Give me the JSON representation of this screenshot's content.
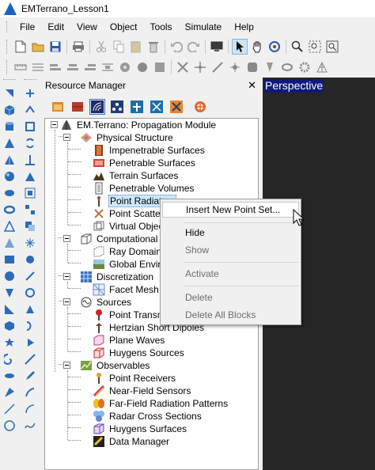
{
  "window": {
    "title": "EMTerrano_Lesson1"
  },
  "menubar": {
    "items": [
      "File",
      "Edit",
      "View",
      "Object",
      "Tools",
      "Simulate",
      "Help"
    ]
  },
  "toolbar1": {
    "icons": [
      "new-icon",
      "open-icon",
      "save-icon",
      "print-icon",
      "cut-icon",
      "copy-icon",
      "paste-icon",
      "delete-icon",
      "undo-icon",
      "redo-icon",
      "display-icon",
      "pointer-icon",
      "pan-icon",
      "rotate-icon",
      "zoom-icon",
      "zoom-window-icon",
      "zoom-fit-icon"
    ]
  },
  "toolbar2": {
    "icons": [
      "ruler-icon",
      "grid-icon",
      "align-left-icon",
      "align-center-icon",
      "align-right-icon",
      "distribute-icon",
      "cylinder-icon",
      "sphere-icon",
      "disk-icon",
      "scissors-icon",
      "snap-icon",
      "line-icon",
      "point-icon",
      "shield-icon",
      "cone-icon",
      "lens-icon",
      "gear-icon",
      "mesh-icon"
    ]
  },
  "left_palette": {
    "column1": [
      "arrow-icon",
      "box-icon",
      "cylinder-icon",
      "cone-icon",
      "pyramid-icon",
      "sphere-icon",
      "disk-icon",
      "torus-icon",
      "wedge-icon",
      "prism-icon",
      "rectangle-icon",
      "circle-icon",
      "polygon-icon",
      "triangle-icon",
      "hexagon-icon",
      "star-icon",
      "spiral-icon",
      "heart-icon",
      "sector-icon",
      "line-icon",
      "curve-icon"
    ],
    "column2": [
      "move-icon",
      "rotate-icon",
      "scale-icon",
      "mirror-icon",
      "array-icon",
      "group-icon",
      "split-icon",
      "join-icon",
      "boolean-icon",
      "fillet-icon",
      "offset-icon",
      "extrude-icon",
      "revolve-icon",
      "sweep-icon",
      "loft-icon",
      "shell-icon",
      "chamfer-icon",
      "pencil-icon",
      "measure-icon",
      "arc-icon",
      "spline-icon"
    ]
  },
  "resource_manager": {
    "title": "Resource Manager",
    "close_symbol": "✕",
    "tools": [
      "open-folder-icon",
      "material-icon",
      "signal-icon",
      "nodes-icon",
      "antenna-icon",
      "network-icon",
      "cross-arrows-icon",
      "target-icon"
    ],
    "root": "EM.Terrano: Propagation Module",
    "tree": [
      {
        "label": "Physical Structure",
        "level": 1,
        "expandable": true,
        "icon": "structure-icon"
      },
      {
        "label": "Impenetrable Surfaces",
        "level": 2,
        "icon": "impenetrable-surface-icon"
      },
      {
        "label": "Penetrable Surfaces",
        "level": 2,
        "icon": "penetrable-surface-icon"
      },
      {
        "label": "Terrain Surfaces",
        "level": 2,
        "icon": "terrain-icon"
      },
      {
        "label": "Penetrable Volumes",
        "level": 2,
        "icon": "volume-icon"
      },
      {
        "label": "Point Radiators",
        "level": 2,
        "icon": "radiator-icon",
        "selected": true
      },
      {
        "label": "Point Scatterers",
        "level": 2,
        "icon": "scatterer-icon"
      },
      {
        "label": "Virtual Objects",
        "level": 2,
        "icon": "virtual-object-icon"
      },
      {
        "label": "Computational Domain",
        "level": 1,
        "expandable": true,
        "icon": "domain-icon"
      },
      {
        "label": "Ray Domain",
        "level": 2,
        "icon": "ray-domain-icon"
      },
      {
        "label": "Global Environment",
        "level": 2,
        "icon": "environment-icon"
      },
      {
        "label": "Discretization",
        "level": 1,
        "expandable": true,
        "icon": "discretization-icon"
      },
      {
        "label": "Facet Mesh",
        "level": 2,
        "icon": "mesh-icon"
      },
      {
        "label": "Sources",
        "level": 1,
        "expandable": true,
        "icon": "sources-icon"
      },
      {
        "label": "Point Transmitters",
        "level": 2,
        "icon": "transmitter-icon"
      },
      {
        "label": "Hertzian Short Dipoles",
        "level": 2,
        "icon": "dipole-icon"
      },
      {
        "label": "Plane Waves",
        "level": 2,
        "icon": "plane-wave-icon"
      },
      {
        "label": "Huygens Sources",
        "level": 2,
        "icon": "huygens-source-icon"
      },
      {
        "label": "Observables",
        "level": 1,
        "expandable": true,
        "icon": "observables-icon"
      },
      {
        "label": "Point Receivers",
        "level": 2,
        "icon": "receiver-icon"
      },
      {
        "label": "Near-Field Sensors",
        "level": 2,
        "icon": "sensor-icon"
      },
      {
        "label": "Far-Field Radiation Patterns",
        "level": 2,
        "icon": "far-field-icon"
      },
      {
        "label": "Radar Cross Sections",
        "level": 2,
        "icon": "rcs-icon"
      },
      {
        "label": "Huygens Surfaces",
        "level": 2,
        "icon": "huygens-surface-icon"
      },
      {
        "label": "Data Manager",
        "level": 2,
        "icon": "data-manager-icon"
      }
    ]
  },
  "viewport": {
    "label": "Perspective"
  },
  "context_menu": {
    "items": [
      {
        "label": "Insert New Point Set...",
        "state": "hover"
      },
      {
        "label": "Hide",
        "state": "enabled"
      },
      {
        "label": "Show",
        "state": "disabled"
      },
      {
        "label": "Activate",
        "state": "disabled"
      },
      {
        "label": "Delete",
        "state": "disabled"
      },
      {
        "label": "Delete All Blocks",
        "state": "disabled"
      }
    ]
  },
  "colors": {
    "viewport_bg": "#262626",
    "viewport_label_bg": "#0f1a7a",
    "selection_bg": "#cce8ff",
    "menu_hover_bg": "#ffffff"
  }
}
